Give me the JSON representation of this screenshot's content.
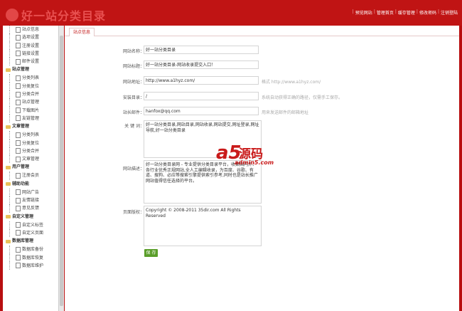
{
  "header": {
    "logo_text": "好一站分类目录",
    "links": [
      "预览网站",
      "管理首页",
      "缓存管理",
      "修改密码",
      "注销登陆"
    ]
  },
  "sidebar": {
    "items": [
      {
        "type": "item",
        "label": "站点信息"
      },
      {
        "type": "item",
        "label": "选项设置"
      },
      {
        "type": "item",
        "label": "注册设置"
      },
      {
        "type": "item",
        "label": "链接设置"
      },
      {
        "type": "item",
        "label": "邮件设置"
      },
      {
        "type": "cat",
        "label": "站点管理"
      },
      {
        "type": "item",
        "label": "分类列表"
      },
      {
        "type": "item",
        "label": "分类复位"
      },
      {
        "type": "item",
        "label": "分类合并"
      },
      {
        "type": "item",
        "label": "站点管理"
      },
      {
        "type": "item",
        "label": "下载图片"
      },
      {
        "type": "item",
        "label": "友链管理"
      },
      {
        "type": "cat",
        "label": "文章管理"
      },
      {
        "type": "item",
        "label": "分类列表"
      },
      {
        "type": "item",
        "label": "分类复位"
      },
      {
        "type": "item",
        "label": "分类合并"
      },
      {
        "type": "item",
        "label": "文章管理"
      },
      {
        "type": "cat",
        "label": "用户管理"
      },
      {
        "type": "item",
        "label": "注册会员"
      },
      {
        "type": "cat",
        "label": "辅助功能"
      },
      {
        "type": "item",
        "label": "网站广告"
      },
      {
        "type": "item",
        "label": "友情链接"
      },
      {
        "type": "item",
        "label": "意见反馈"
      },
      {
        "type": "cat",
        "label": "自定义管理"
      },
      {
        "type": "item",
        "label": "自定义标签"
      },
      {
        "type": "item",
        "label": "自定义页面"
      },
      {
        "type": "cat",
        "label": "数据库管理"
      },
      {
        "type": "item",
        "label": "数据库备份"
      },
      {
        "type": "item",
        "label": "数据库恢复"
      },
      {
        "type": "item",
        "label": "数据库维护"
      }
    ]
  },
  "tab": {
    "label": "站点信息"
  },
  "form": {
    "site_name": {
      "label": "网站名称：",
      "value": "好一站分类目录"
    },
    "site_title": {
      "label": "网站标题：",
      "value": "好一站分类目录-网站收录提交入口！"
    },
    "site_url": {
      "label": "网站地址：",
      "value": "http://www.a1hyz.com/",
      "hint": "格式 http://www.a1hyz.com/"
    },
    "install_dir": {
      "label": "安装目录：",
      "value": "/",
      "hint": "系统自动获得正确的路径，仅需手工保存。"
    },
    "admin_email": {
      "label": "站长邮件：",
      "value": "hanfox@qq.com",
      "hint": "用来发送邮件的邮箱地址"
    },
    "keywords": {
      "label": "关 键 词：",
      "value": "好一站分类目录,网站目录,网站收录,网站提交,网址登录,网址导航,好一站分类目录"
    },
    "description": {
      "label": "网站描述：",
      "value": "好一站分类目录网 - 专业提供分类目录平台，收集国内外、各行业优秀正规网站,全人工编辑收录，为百度、谷歌、有道、搜狗、必应等搜索引擎提供索引参考,同时也是站长推广网站值得信任选择的平台。"
    },
    "copyright": {
      "label": "页面版权：",
      "value": "Copyright © 2008-2011 35dir.com All Rights Reserved"
    },
    "save_label": "保 存"
  },
  "watermark": {
    "logo": "a5",
    "cn": "源码",
    "url": "admin5.com"
  }
}
